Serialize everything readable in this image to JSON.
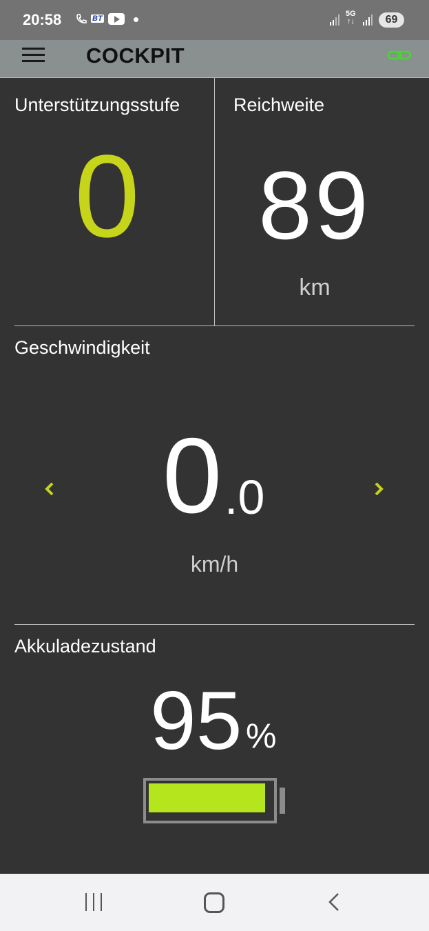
{
  "status_bar": {
    "time": "20:58",
    "bt_label": "BT",
    "network": "5G",
    "battery_level": "69"
  },
  "app_bar": {
    "title": "COCKPIT",
    "menu_icon": "hamburger-menu-icon",
    "link_icon": "link-icon",
    "link_color": "#4cd137"
  },
  "assist": {
    "label": "Unterstützungsstufe",
    "value": "0",
    "color": "#c6d41a"
  },
  "range": {
    "label": "Reichweite",
    "value": "89",
    "unit": "km"
  },
  "speed": {
    "label": "Geschwindigkeit",
    "integer": "0",
    "decimal": ".0",
    "unit": "km/h",
    "arrow_color": "#c6d41a"
  },
  "battery": {
    "label": "Akkuladezustand",
    "value": "95",
    "unit": "%",
    "fill_fraction": 0.95,
    "fill_color": "#b5e61d"
  },
  "nav_bar": {
    "recent_icon": "recent-apps-icon",
    "home_icon": "home-icon",
    "back_icon": "back-icon"
  }
}
